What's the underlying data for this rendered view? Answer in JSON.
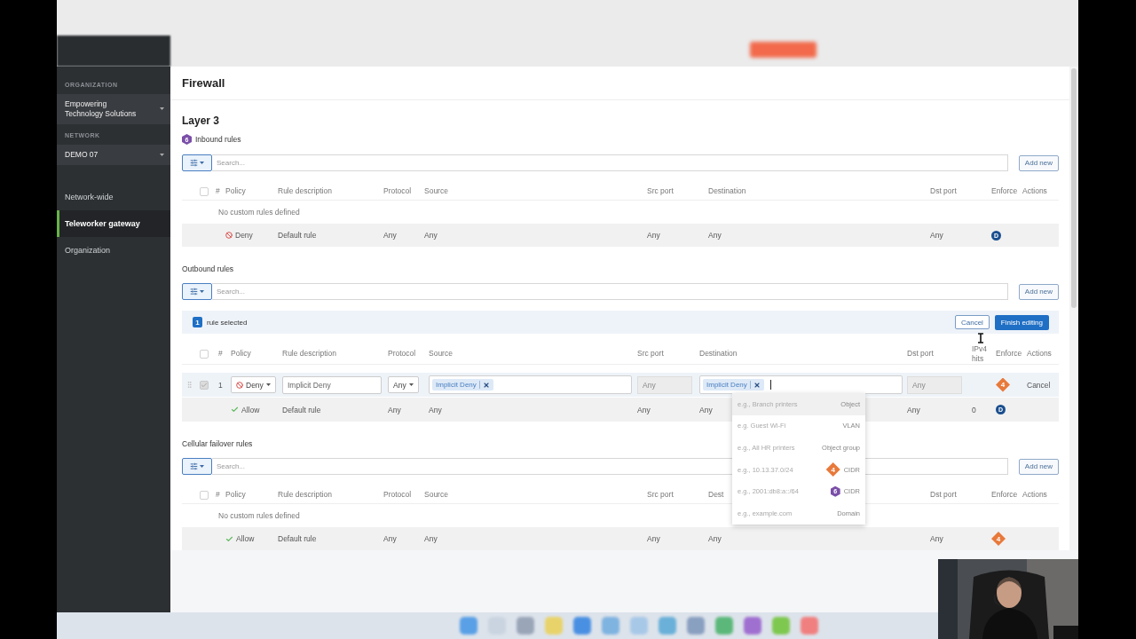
{
  "sidebar": {
    "sections": [
      {
        "label": "ORGANIZATION",
        "value": "Empowering Technology Solutions"
      },
      {
        "label": "NETWORK",
        "value": "DEMO 07"
      }
    ],
    "items": [
      {
        "label": "Network-wide",
        "selected": false
      },
      {
        "label": "Teleworker gateway",
        "selected": true
      },
      {
        "label": "Organization",
        "selected": false
      }
    ]
  },
  "page": {
    "title": "Firewall",
    "section_title": "Layer 3"
  },
  "rule_tables": [
    {
      "kind": "standard",
      "title": "Inbound rules",
      "badge": {
        "kind": "ipv6",
        "label": "6"
      },
      "search": {
        "placeholder": "Search..."
      },
      "add_button": "Add new",
      "all_selected": false,
      "columns": [
        "#",
        "Policy",
        "Rule description",
        "Protocol",
        "Source",
        "Src port",
        "Destination",
        "Dst port",
        "Enforce",
        "Actions"
      ],
      "empty_text": "No custom rules defined",
      "rows": [
        {
          "kind": "default",
          "policy": {
            "kind": "deny",
            "label": "Deny"
          },
          "description": "Default rule",
          "protocol": "Any",
          "source": "Any",
          "src_port": "Any",
          "destination": "Any",
          "dst_port": "Any",
          "enforce": {
            "kind": "default",
            "label": "D"
          }
        }
      ]
    },
    {
      "kind": "editing",
      "title": "Outbound rules",
      "search": {
        "placeholder": "Search..."
      },
      "add_button": "Add new",
      "all_selected": false,
      "selection_bar": {
        "count": "1",
        "text": "rule selected",
        "cancel": "Cancel",
        "finish": "Finish editing"
      },
      "columns": [
        "#",
        "Policy",
        "Rule description",
        "Protocol",
        "Source",
        "Src port",
        "Destination",
        "Dst port",
        "IPv4 hits",
        "Enforce",
        "Actions"
      ],
      "rows": [
        {
          "kind": "edit",
          "checked": true,
          "number": "1",
          "policy": {
            "kind": "deny",
            "label": "Deny"
          },
          "description": "Implicit Deny",
          "protocol": "Any",
          "source": {
            "tags": [
              "Implicit Deny"
            ]
          },
          "src_port": {
            "value": "Any",
            "disabled": true
          },
          "destination": {
            "tags": [
              "Implicit Deny"
            ],
            "suggestions": [
              {
                "hint": "e.g., Branch printers",
                "type": "Object",
                "selected": true
              },
              {
                "hint": "e.g. Guest Wi-Fi",
                "type": "VLAN",
                "selected": false
              },
              {
                "hint": "e.g., All HR printers",
                "type": "Object group",
                "selected": false
              },
              {
                "hint": "e.g., 10.13.37.0/24",
                "type": "CIDR",
                "badge": {
                  "kind": "ipv4",
                  "label": "4"
                },
                "selected": false
              },
              {
                "hint": "e.g., 2001:db8:a::/64",
                "type": "CIDR",
                "badge": {
                  "kind": "ipv6",
                  "label": "6"
                },
                "selected": false
              },
              {
                "hint": "e.g., example.com",
                "type": "Domain",
                "selected": false
              }
            ]
          },
          "dst_port": {
            "value": "Any",
            "disabled": true
          },
          "enforce": {
            "kind": "ipv4",
            "label": "4"
          },
          "action": "Cancel"
        },
        {
          "kind": "default",
          "policy": {
            "kind": "allow",
            "label": "Allow"
          },
          "description": "Default rule",
          "protocol": "Any",
          "source": "Any",
          "src_port": "Any",
          "destination": "Any",
          "dst_port": "Any",
          "hits": "0",
          "enforce": {
            "kind": "default",
            "label": "D"
          }
        }
      ]
    },
    {
      "kind": "standard",
      "title": "Cellular failover rules",
      "search": {
        "placeholder": "Search..."
      },
      "add_button": "Add new",
      "all_selected": false,
      "columns": [
        "#",
        "Policy",
        "Rule description",
        "Protocol",
        "Source",
        "Src port",
        "Dest",
        "Dst port",
        "Enforce",
        "Actions"
      ],
      "empty_text": "No custom rules defined",
      "rows": [
        {
          "kind": "default",
          "policy": {
            "kind": "allow",
            "label": "Allow"
          },
          "description": "Default rule",
          "protocol": "Any",
          "source": "Any",
          "src_port": "Any",
          "destination": "Any",
          "dst_port": "Any",
          "enforce": {
            "kind": "ipv4",
            "label": "4"
          }
        }
      ]
    }
  ]
}
